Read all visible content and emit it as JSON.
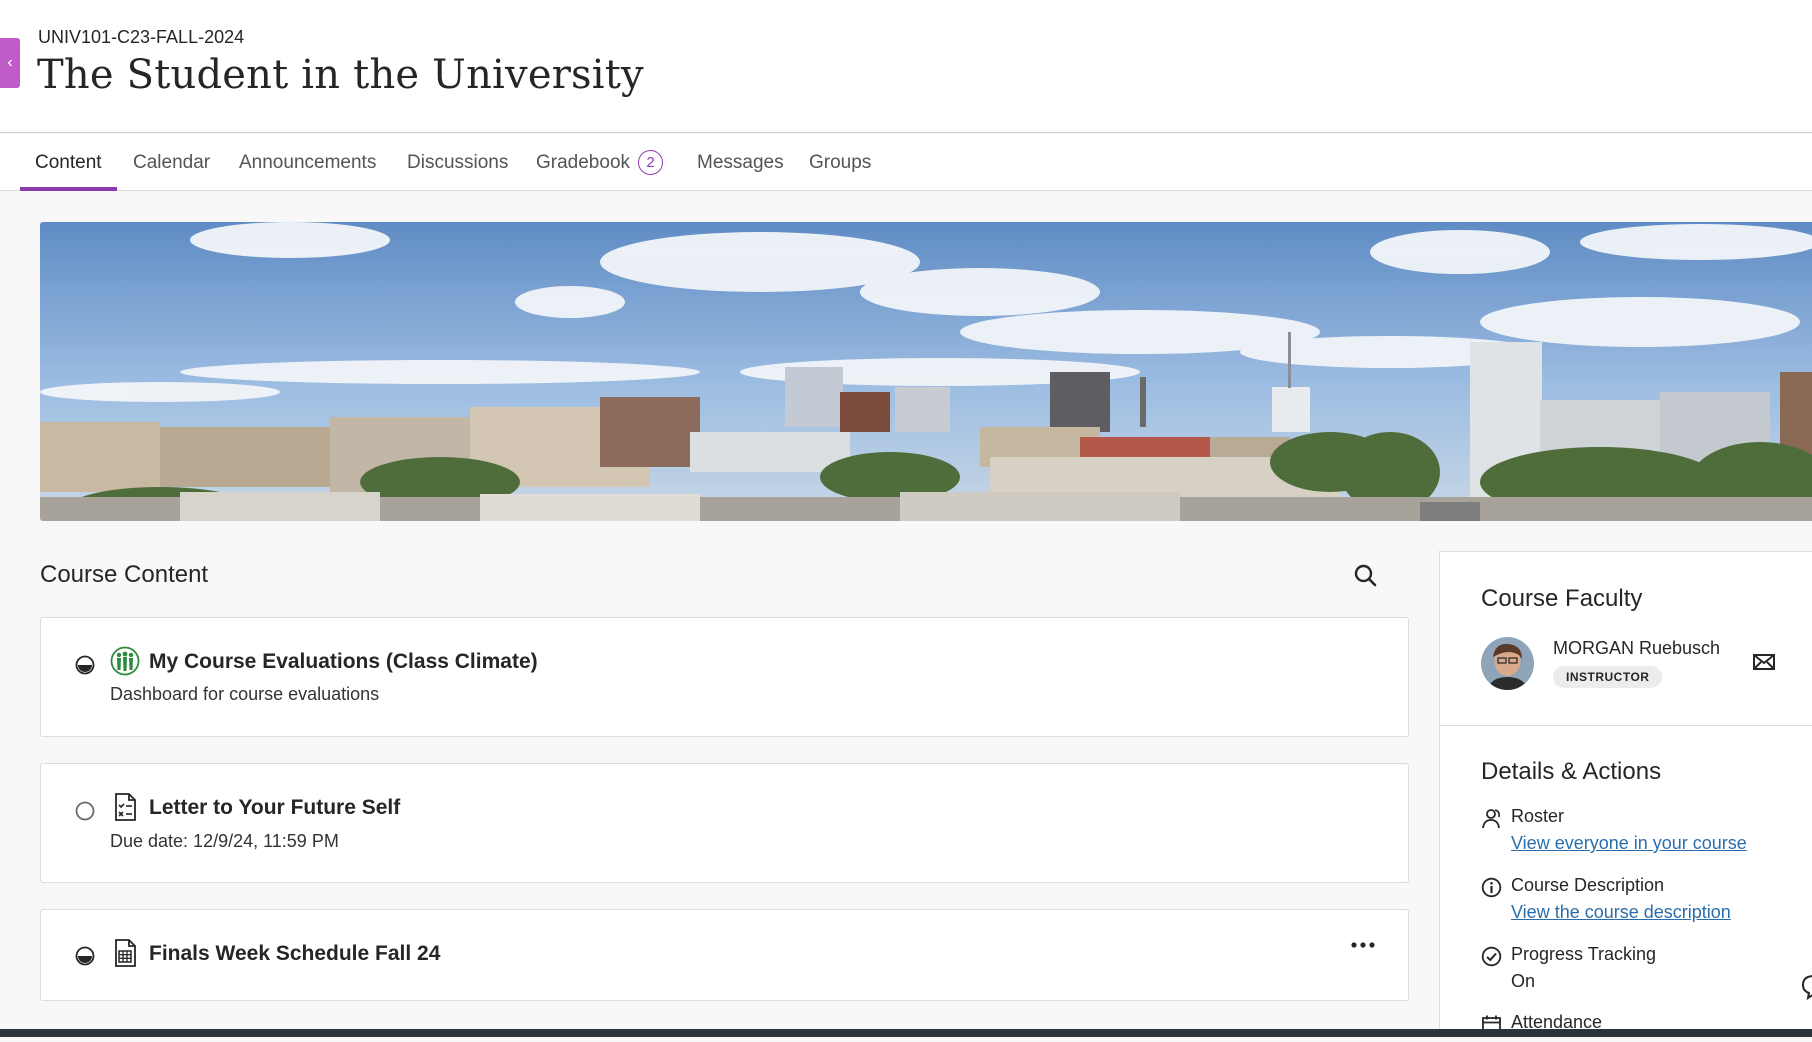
{
  "header": {
    "course_id": "UNIV101-C23-FALL-2024",
    "course_title": "The Student in the University",
    "close_label": "‹"
  },
  "tabs": [
    {
      "label": "Content",
      "active": true
    },
    {
      "label": "Calendar"
    },
    {
      "label": "Announcements"
    },
    {
      "label": "Discussions"
    },
    {
      "label": "Gradebook",
      "badge": "2"
    },
    {
      "label": "Messages"
    },
    {
      "label": "Groups"
    }
  ],
  "banner": {
    "icon": "campus-skyline-photo"
  },
  "course_content": {
    "title": "Course Content",
    "items": [
      {
        "title": "My Course Evaluations (Class Climate)",
        "subtitle": "Dashboard for course evaluations",
        "icon": "evaluation-people-icon",
        "status": "half-complete"
      },
      {
        "title": "Letter to Your Future Self",
        "subtitle": "Due date: 12/9/24, 11:59 PM",
        "icon": "assignment-icon",
        "status": "not-started"
      },
      {
        "title": "Finals Week Schedule Fall 24",
        "subtitle": "",
        "icon": "spreadsheet-icon",
        "status": "half-complete",
        "has_more": true
      }
    ]
  },
  "faculty": {
    "title": "Course Faculty",
    "name": "MORGAN Ruebusch",
    "role": "INSTRUCTOR"
  },
  "details": {
    "title": "Details & Actions",
    "rows": [
      {
        "label": "Roster",
        "value": "View everyone in your course",
        "link": true,
        "icon": "roster-icon"
      },
      {
        "label": "Course Description",
        "value": "View the course description",
        "link": true,
        "icon": "info-icon"
      },
      {
        "label": "Progress Tracking",
        "value": "On",
        "link": false,
        "icon": "check-circle-icon"
      },
      {
        "label": "Attendance",
        "value": "",
        "link": false,
        "icon": "calendar-icon"
      }
    ]
  },
  "colors": {
    "accent": "#8e3bb0",
    "close_tab": "#c05cc9",
    "link": "#2a6dac"
  }
}
